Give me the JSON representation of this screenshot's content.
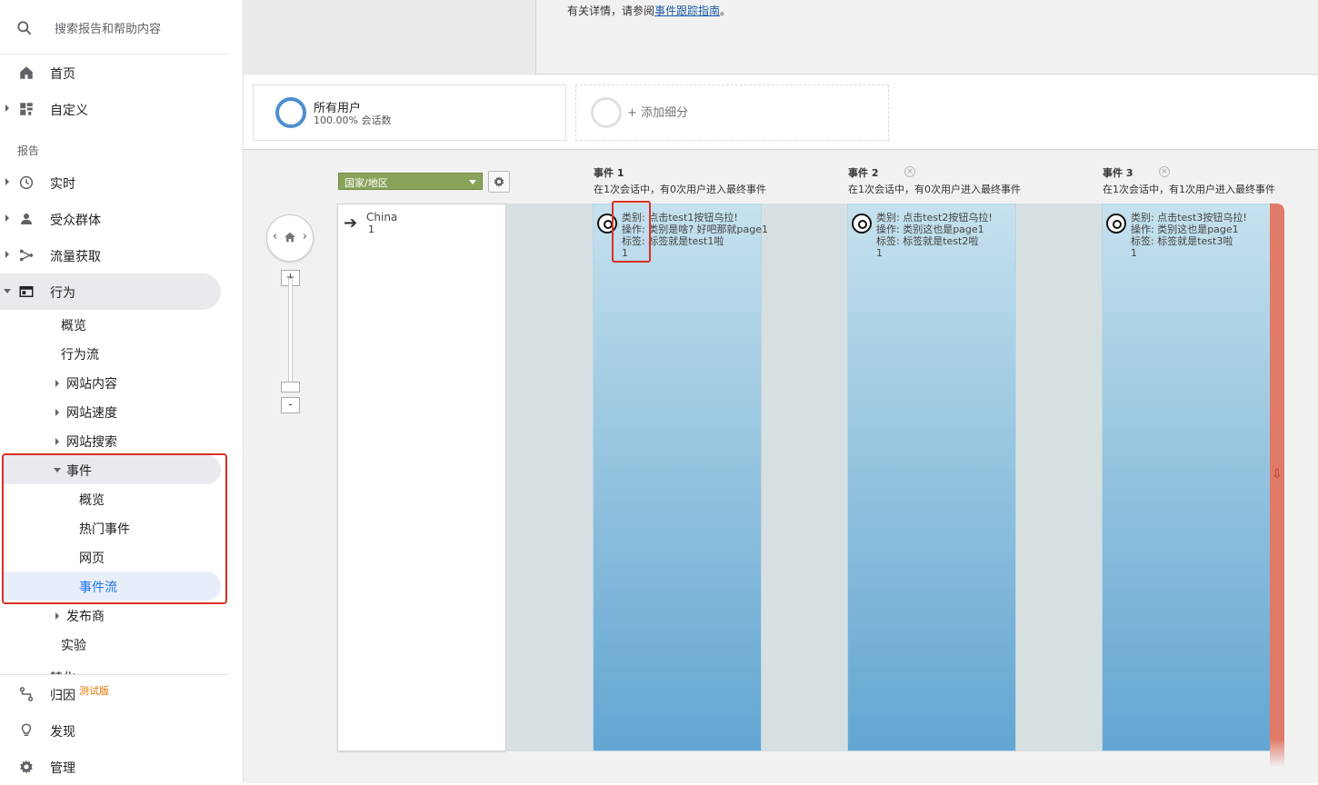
{
  "sidebar": {
    "search_placeholder": "搜索报告和帮助内容",
    "home": "首页",
    "customize": "自定义",
    "reports_section": "报告",
    "realtime": "实时",
    "audience": "受众群体",
    "acquisition": "流量获取",
    "behavior": "行为",
    "behavior_sub": {
      "overview": "概览",
      "flow": "行为流",
      "site_content": "网站内容",
      "site_speed": "网站速度",
      "site_search": "网站搜索",
      "events": "事件",
      "events_sub": {
        "overview": "概览",
        "top_events": "热门事件",
        "pages": "网页",
        "events_flow": "事件流"
      },
      "publisher": "发布商",
      "experiments": "实验"
    },
    "conversions_partial": "转化",
    "attribution": "归因",
    "beta_badge": "测试版",
    "discover": "发现",
    "admin": "管理"
  },
  "topbar": {
    "info_prefix": "有关详情，请参阅",
    "info_link": "事件跟踪指南",
    "info_suffix": "。"
  },
  "segments": {
    "all_users_title": "所有用户",
    "all_users_sub": "100.00% 会话数",
    "add_segment": "+ 添加细分"
  },
  "flow": {
    "dimension": "国家/地区",
    "zoom_in": "+",
    "zoom_out": "-",
    "start_node": {
      "name": "China",
      "count": "1"
    },
    "columns": [
      {
        "title": "事件 1",
        "subtitle": "在1次会话中，有0次用户进入最终事件",
        "category": "类别: 点击test1按钮乌拉!",
        "action": "操作: 类别是啥? 好吧那就page1",
        "label": "标签: 标签就是test1啦",
        "count": "1"
      },
      {
        "title": "事件 2",
        "subtitle": "在1次会话中，有0次用户进入最终事件",
        "category": "类别: 点击test2按钮乌拉!",
        "action": "操作: 类别这也是page1",
        "label": "标签: 标签就是test2啦",
        "count": "1"
      },
      {
        "title": "事件 3",
        "subtitle": "在1次会话中，有1次用户进入最终事件",
        "category": "类别: 点击test3按钮乌拉!",
        "action": "操作: 类别这也是page1",
        "label": "标签: 标签就是test3啦",
        "count": "1"
      }
    ],
    "colors": {
      "node_top": "#c6e1ee",
      "node_bottom": "#63a6d2",
      "dropoff": "#e07b69",
      "highlight": "#d93025",
      "dimension_bg": "#8aa35a"
    }
  }
}
